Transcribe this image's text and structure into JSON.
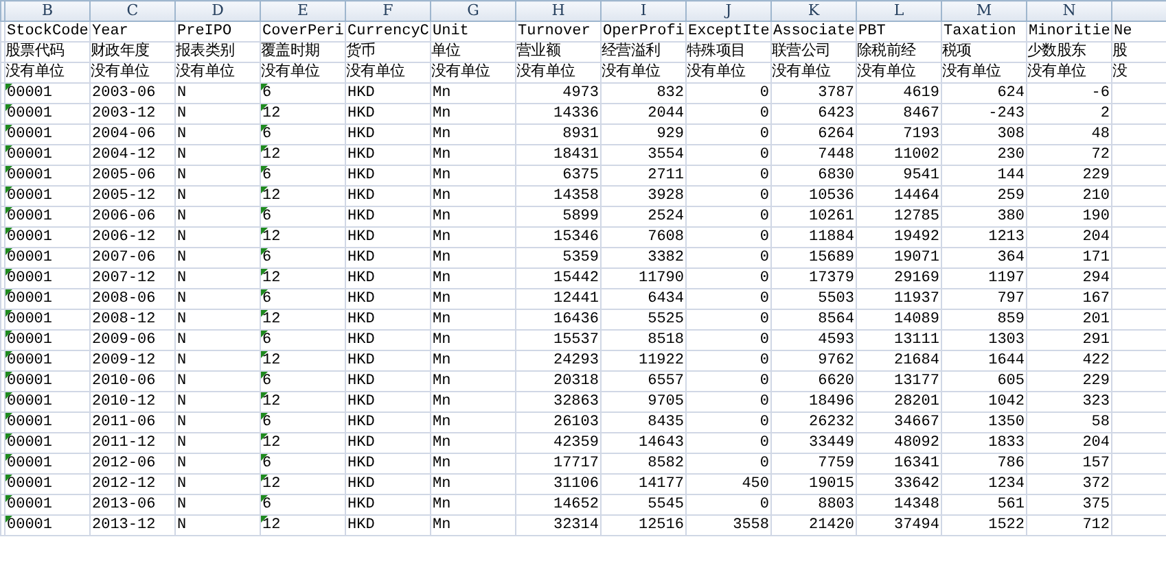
{
  "columns": [
    {
      "letter": "B",
      "name": "StockCode",
      "label": "股票代码",
      "unit": "没有单位",
      "kind": "text",
      "number_stored_as_text": true
    },
    {
      "letter": "C",
      "name": "Year",
      "label": "财政年度",
      "unit": "没有单位",
      "kind": "text"
    },
    {
      "letter": "D",
      "name": "PreIPO",
      "label": "报表类别",
      "unit": "没有单位",
      "kind": "text"
    },
    {
      "letter": "E",
      "name": "CoverPeri",
      "label": "覆盖时期",
      "unit": "没有单位",
      "kind": "text",
      "number_stored_as_text": true
    },
    {
      "letter": "F",
      "name": "CurrencyC",
      "label": "货币",
      "unit": "没有单位",
      "kind": "text"
    },
    {
      "letter": "G",
      "name": "Unit",
      "label": "单位",
      "unit": "没有单位",
      "kind": "text"
    },
    {
      "letter": "H",
      "name": "Turnover",
      "label": "营业额",
      "unit": "没有单位",
      "kind": "number"
    },
    {
      "letter": "I",
      "name": "OperProfi",
      "label": "经营溢利",
      "unit": "没有单位",
      "kind": "number"
    },
    {
      "letter": "J",
      "name": "ExceptIte",
      "label": "特殊项目",
      "unit": "没有单位",
      "kind": "number"
    },
    {
      "letter": "K",
      "name": "Associate",
      "label": "联营公司",
      "unit": "没有单位",
      "kind": "number"
    },
    {
      "letter": "L",
      "name": "PBT",
      "label": "除税前经",
      "unit": "没有单位",
      "kind": "number"
    },
    {
      "letter": "M",
      "name": "Taxation",
      "label": "税项",
      "unit": "没有单位",
      "kind": "number"
    },
    {
      "letter": "N",
      "name": "Minoritie",
      "label": "少数股东",
      "unit": "没有单位",
      "kind": "number"
    },
    {
      "name": "Ne",
      "label": "股",
      "unit": "没"
    }
  ],
  "rows": [
    [
      "00001",
      "2003-06",
      "N",
      "6",
      "HKD",
      "Mn",
      "4973",
      "832",
      "0",
      "3787",
      "4619",
      "624",
      "-6"
    ],
    [
      "00001",
      "2003-12",
      "N",
      "12",
      "HKD",
      "Mn",
      "14336",
      "2044",
      "0",
      "6423",
      "8467",
      "-243",
      "2"
    ],
    [
      "00001",
      "2004-06",
      "N",
      "6",
      "HKD",
      "Mn",
      "8931",
      "929",
      "0",
      "6264",
      "7193",
      "308",
      "48"
    ],
    [
      "00001",
      "2004-12",
      "N",
      "12",
      "HKD",
      "Mn",
      "18431",
      "3554",
      "0",
      "7448",
      "11002",
      "230",
      "72"
    ],
    [
      "00001",
      "2005-06",
      "N",
      "6",
      "HKD",
      "Mn",
      "6375",
      "2711",
      "0",
      "6830",
      "9541",
      "144",
      "229"
    ],
    [
      "00001",
      "2005-12",
      "N",
      "12",
      "HKD",
      "Mn",
      "14358",
      "3928",
      "0",
      "10536",
      "14464",
      "259",
      "210"
    ],
    [
      "00001",
      "2006-06",
      "N",
      "6",
      "HKD",
      "Mn",
      "5899",
      "2524",
      "0",
      "10261",
      "12785",
      "380",
      "190"
    ],
    [
      "00001",
      "2006-12",
      "N",
      "12",
      "HKD",
      "Mn",
      "15346",
      "7608",
      "0",
      "11884",
      "19492",
      "1213",
      "204"
    ],
    [
      "00001",
      "2007-06",
      "N",
      "6",
      "HKD",
      "Mn",
      "5359",
      "3382",
      "0",
      "15689",
      "19071",
      "364",
      "171"
    ],
    [
      "00001",
      "2007-12",
      "N",
      "12",
      "HKD",
      "Mn",
      "15442",
      "11790",
      "0",
      "17379",
      "29169",
      "1197",
      "294"
    ],
    [
      "00001",
      "2008-06",
      "N",
      "6",
      "HKD",
      "Mn",
      "12441",
      "6434",
      "0",
      "5503",
      "11937",
      "797",
      "167"
    ],
    [
      "00001",
      "2008-12",
      "N",
      "12",
      "HKD",
      "Mn",
      "16436",
      "5525",
      "0",
      "8564",
      "14089",
      "859",
      "201"
    ],
    [
      "00001",
      "2009-06",
      "N",
      "6",
      "HKD",
      "Mn",
      "15537",
      "8518",
      "0",
      "4593",
      "13111",
      "1303",
      "291"
    ],
    [
      "00001",
      "2009-12",
      "N",
      "12",
      "HKD",
      "Mn",
      "24293",
      "11922",
      "0",
      "9762",
      "21684",
      "1644",
      "422"
    ],
    [
      "00001",
      "2010-06",
      "N",
      "6",
      "HKD",
      "Mn",
      "20318",
      "6557",
      "0",
      "6620",
      "13177",
      "605",
      "229"
    ],
    [
      "00001",
      "2010-12",
      "N",
      "12",
      "HKD",
      "Mn",
      "32863",
      "9705",
      "0",
      "18496",
      "28201",
      "1042",
      "323"
    ],
    [
      "00001",
      "2011-06",
      "N",
      "6",
      "HKD",
      "Mn",
      "26103",
      "8435",
      "0",
      "26232",
      "34667",
      "1350",
      "58"
    ],
    [
      "00001",
      "2011-12",
      "N",
      "12",
      "HKD",
      "Mn",
      "42359",
      "14643",
      "0",
      "33449",
      "48092",
      "1833",
      "204"
    ],
    [
      "00001",
      "2012-06",
      "N",
      "6",
      "HKD",
      "Mn",
      "17717",
      "8582",
      "0",
      "7759",
      "16341",
      "786",
      "157"
    ],
    [
      "00001",
      "2012-12",
      "N",
      "12",
      "HKD",
      "Mn",
      "31106",
      "14177",
      "450",
      "19015",
      "33642",
      "1234",
      "372"
    ],
    [
      "00001",
      "2013-06",
      "N",
      "6",
      "HKD",
      "Mn",
      "14652",
      "5545",
      "0",
      "8803",
      "14348",
      "561",
      "375"
    ],
    [
      "00001",
      "2013-12",
      "N",
      "12",
      "HKD",
      "Mn",
      "32314",
      "12516",
      "3558",
      "21420",
      "37494",
      "1522",
      "712"
    ]
  ]
}
